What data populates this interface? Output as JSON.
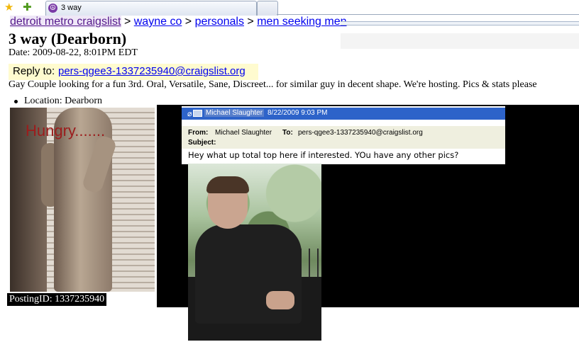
{
  "browser": {
    "tab_title": "3 way",
    "tab_icon": "peace-icon",
    "bookmark_icon": "star-icon",
    "add_bookmark_icon": "add-bookmark-icon"
  },
  "breadcrumb": {
    "items": [
      "detroit metro craigslist",
      "wayne co",
      "personals",
      "men seeking men"
    ],
    "separator": ">"
  },
  "post": {
    "title": "3 way (Dearborn)",
    "date": "Date: 2009-08-22, 8:01PM EDT",
    "reply_label": "Reply to:",
    "reply_email": "pers-qgee3-1337235940@craigslist.org",
    "body": "Gay Couple looking for a fun 3rd. Oral, Versatile, Sane, Discreet... for similar guy in decent shape. We're hosting. Pics & stats please",
    "location": "Location: Dearborn",
    "photo_caption": "Hungry.......",
    "posting_id": "PostingID: 1337235940"
  },
  "email": {
    "sender": "Michael Slaughter",
    "sent_date": "8/22/2009 9:03 PM",
    "from_label": "From:",
    "from_value": "Michael Slaughter",
    "to_label": "To:",
    "to_value": "pers-qgee3-1337235940@craigslist.org",
    "subject_label": "Subject:",
    "subject_value": "",
    "message": "Hey what up total top here if interested. YOu have any other pics?",
    "header_color": "#2d63c9"
  },
  "colors": {
    "link": "#0000ee",
    "visited_link": "#551a8b",
    "reply_bg": "#fffbcf"
  }
}
